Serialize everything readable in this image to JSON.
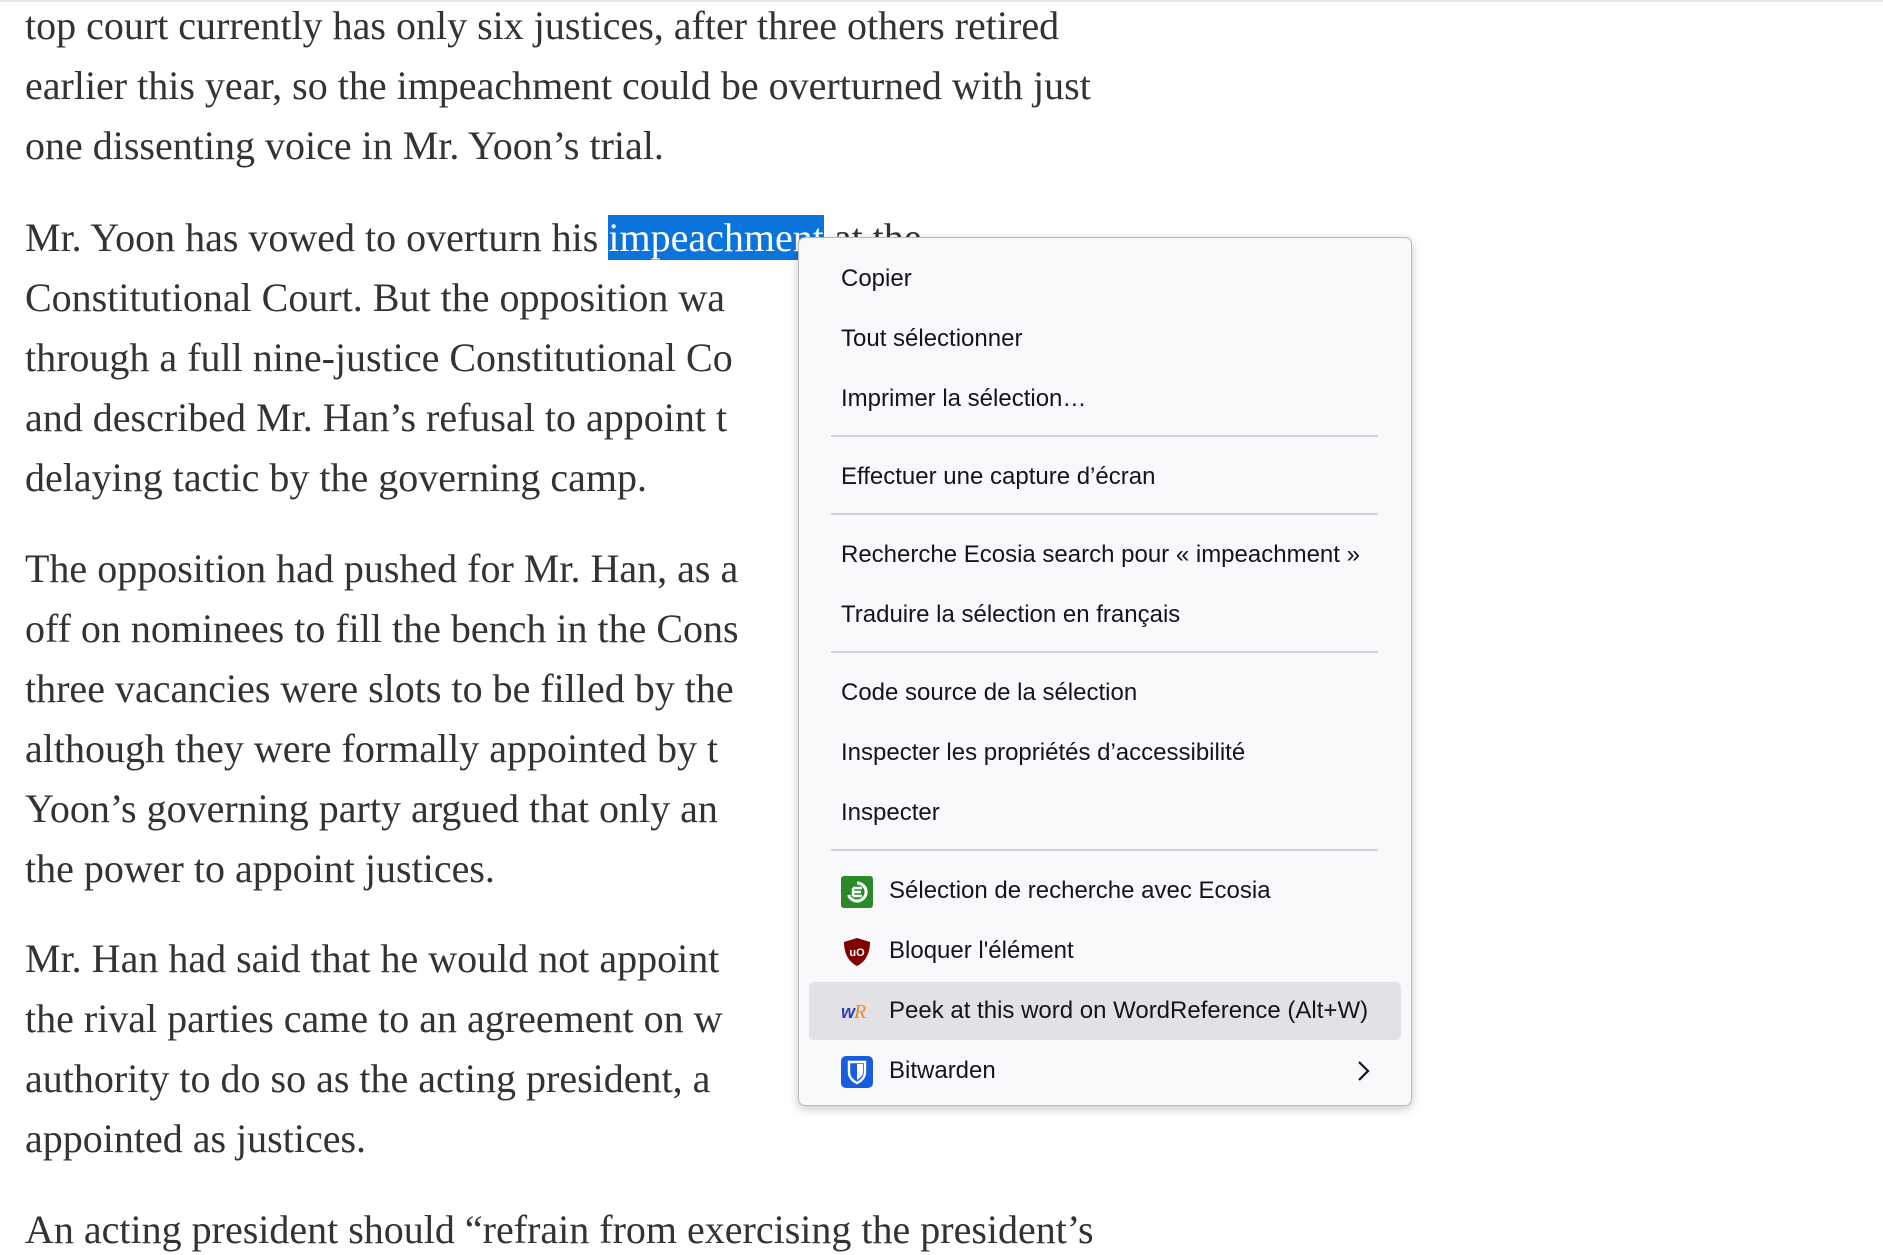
{
  "article": {
    "lines": [
      "top court currently has only six justices, after three others retired",
      "earlier this year, so the impeachment could be overturned with just",
      "one dissenting voice in Mr. Yoon’s trial.",
      "Mr. Yoon has vowed to overturn his ",
      "Constitutional Court. But the opposition wa",
      "through a full nine-justice Constitutional Co",
      "and described Mr. Han’s refusal to appoint t",
      "delaying tactic by the governing camp.",
      "The opposition had pushed for Mr. Han, as a",
      "off on nominees to fill the bench in the Cons",
      "three vacancies were slots to be filled by the",
      "although they were formally appointed by t",
      "Yoon’s governing party argued that only an",
      "the power to appoint justices.",
      "Mr. Han had said that he would not appoint",
      "the rival parties came to an agreement on w",
      "authority to do so as the acting president, a",
      "appointed as justices.",
      "An acting president should “refrain from exercising the president’s"
    ],
    "selected_word": "impeachment",
    "after_selection": " at the"
  },
  "context_menu": {
    "items": [
      {
        "label": "Copier"
      },
      {
        "label": "Tout sélectionner"
      },
      {
        "label": "Imprimer la sélection…"
      },
      {
        "label": "Effectuer une capture d’écran"
      },
      {
        "label": "Recherche Ecosia search pour « impeachment »"
      },
      {
        "label": "Traduire la sélection en français"
      },
      {
        "label": "Code source de la sélection"
      },
      {
        "label": "Inspecter les propriétés d’accessibilité"
      },
      {
        "label": "Inspecter"
      },
      {
        "label": "Sélection de recherche avec Ecosia",
        "icon": "ecosia-icon"
      },
      {
        "label": "Bloquer l'élément",
        "icon": "ublock-origin-icon"
      },
      {
        "label": "Peek at this word on WordReference (Alt+W)",
        "icon": "wordreference-icon"
      },
      {
        "label": "Bitwarden",
        "icon": "bitwarden-shield-icon",
        "submenu_icon": "chevron-right-icon"
      }
    ]
  },
  "colors": {
    "selection_bg": "#0a74dc",
    "menu_bg": "#f9f9fb",
    "menu_hover_bg": "#e1e1e6",
    "ecosia_green": "#2a8a2a",
    "ublock_red": "#800000",
    "wordreference_blue": "#2b3fb8",
    "wordreference_orange": "#f08b2a",
    "bitwarden_blue": "#175ddc"
  }
}
